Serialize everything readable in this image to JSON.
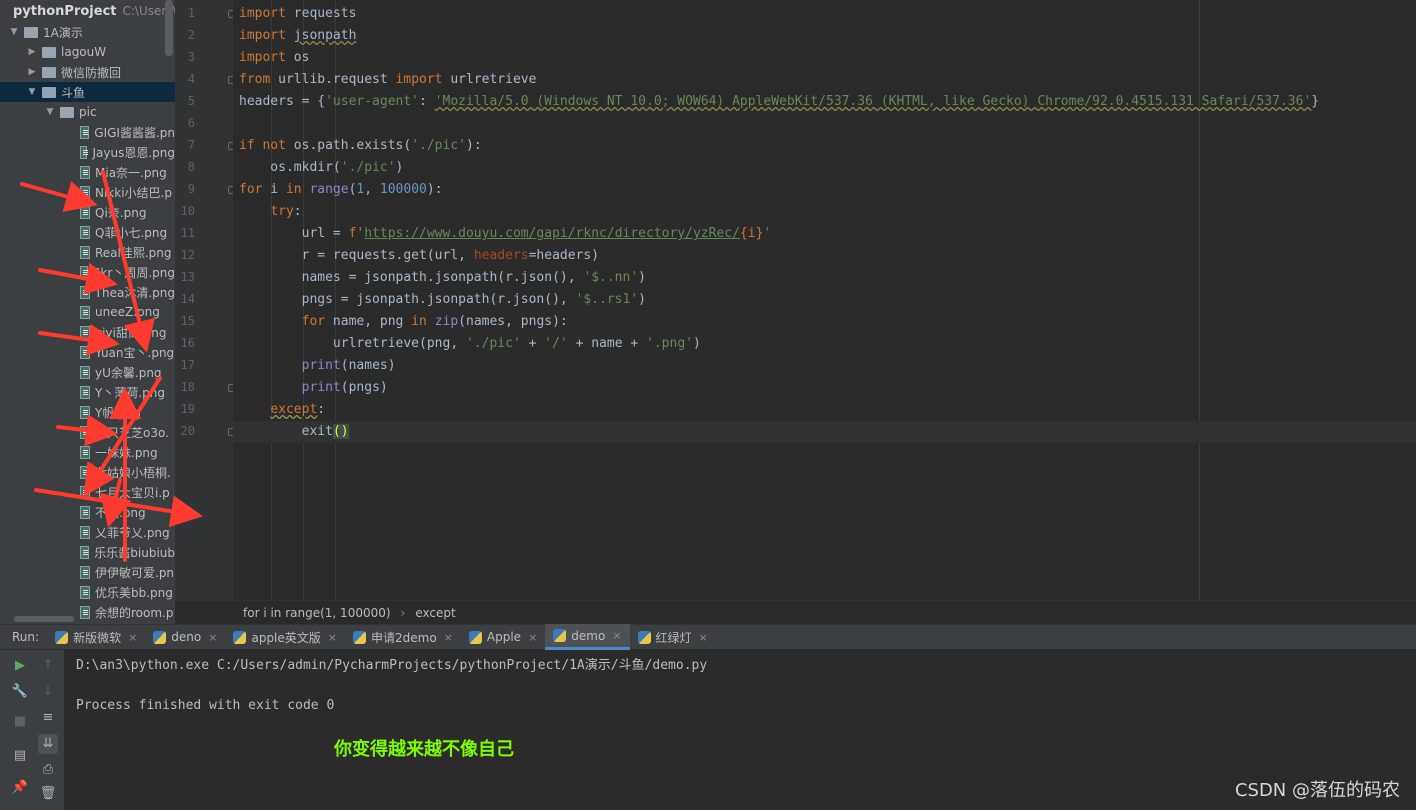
{
  "project": {
    "name": "pythonProject",
    "path": "C:\\Users\\"
  },
  "tree": [
    {
      "label": "1A演示",
      "type": "folder",
      "expanded": true,
      "level": 0
    },
    {
      "label": "lagouW",
      "type": "folder",
      "expanded": false,
      "level": 1
    },
    {
      "label": "微信防撤回",
      "type": "folder",
      "expanded": false,
      "level": 1
    },
    {
      "label": "斗鱼",
      "type": "folder",
      "expanded": true,
      "level": 1,
      "selected": true
    },
    {
      "label": "pic",
      "type": "folder",
      "expanded": true,
      "level": 2
    },
    {
      "label": "GIGI酱酱酱.pn",
      "type": "file",
      "level": 3
    },
    {
      "label": "Jayus恩恩.png",
      "type": "file",
      "level": 3
    },
    {
      "label": "Mia奈一.png",
      "type": "file",
      "level": 3
    },
    {
      "label": "Nikki小结巴.p",
      "type": "file",
      "level": 3
    },
    {
      "label": "Qi奈.png",
      "type": "file",
      "level": 3
    },
    {
      "label": "Q菲小七.png",
      "type": "file",
      "level": 3
    },
    {
      "label": "Real佳熙.png",
      "type": "file",
      "level": 3
    },
    {
      "label": "Skr丶周周.png",
      "type": "file",
      "level": 3
    },
    {
      "label": "Thea沐清.png",
      "type": "file",
      "level": 3
    },
    {
      "label": "uneeZ.png",
      "type": "file",
      "level": 3
    },
    {
      "label": "yiyi甜筒.png",
      "type": "file",
      "level": 3
    },
    {
      "label": "Yuan宝丶.png",
      "type": "file",
      "level": 3
    },
    {
      "label": "yU余馨.png",
      "type": "file",
      "level": 3
    },
    {
      "label": "Y丶薄荷.png",
      "type": "file",
      "level": 3
    },
    {
      "label": "Y帆.png",
      "type": "file",
      "level": 3
    },
    {
      "label": "一只芝芝o3o.",
      "type": "file",
      "level": 3
    },
    {
      "label": "一妹妹.png",
      "type": "file",
      "level": 3
    },
    {
      "label": "七姑娘小梧桐.",
      "type": "file",
      "level": 3
    },
    {
      "label": "七月大宝贝i.p",
      "type": "file",
      "level": 3
    },
    {
      "label": "不然.png",
      "type": "file",
      "level": 3
    },
    {
      "label": "乂菲爷乂.png",
      "type": "file",
      "level": 3
    },
    {
      "label": "乐乐酱biubiub",
      "type": "file",
      "level": 3
    },
    {
      "label": "伊伊敏可爱.pn",
      "type": "file",
      "level": 3
    },
    {
      "label": "优乐美bb.png",
      "type": "file",
      "level": 3
    },
    {
      "label": "余想的room.p",
      "type": "file",
      "level": 3
    }
  ],
  "line_numbers": [
    "1",
    "2",
    "3",
    "4",
    "5",
    "6",
    "7",
    "8",
    "9",
    "10",
    "11",
    "12",
    "13",
    "14",
    "15",
    "16",
    "17",
    "18",
    "19",
    "20"
  ],
  "code": {
    "l1a": "import",
    "l1b": " requests",
    "l2a": "import",
    "l2b": " ",
    "l2c": "jsonpath",
    "l3a": "import",
    "l3b": " os",
    "l4a": "from",
    "l4b": " urllib.request ",
    "l4c": "import",
    "l4d": " urlretrieve",
    "l5a": "headers = {",
    "l5b": "'user-agent'",
    "l5c": ": ",
    "l5d": "'Mozilla/5.0 (Windows NT 10.0; WOW64) AppleWebKit/537.36 (KHTML, like Gecko) Chrome/92.0.4515.131 Safari/537.36'",
    "l5e": "}",
    "l7a": "if not",
    "l7b": " os.path.exists(",
    "l7c": "'./pic'",
    "l7d": "):",
    "l8a": "    os.mkdir(",
    "l8b": "'./pic'",
    "l8c": ")",
    "l9a": "for",
    "l9b": " i ",
    "l9c": "in",
    "l9d": " ",
    "l9e": "range",
    "l9f": "(",
    "l9g": "1",
    "l9h": ", ",
    "l9i": "100000",
    "l9j": "):",
    "l10a": "    ",
    "l10b": "try",
    "l10c": ":",
    "l11a": "        url = ",
    "l11b": "f'",
    "l11c": "https://www.douyu.com/gapi/rknc/directory/yzRec/",
    "l11d": "{i}",
    "l11e": "'",
    "l12a": "        r = requests.get(url, ",
    "l12b": "headers",
    "l12c": "=headers)",
    "l13a": "        names = jsonpath.jsonpath(r.json(), ",
    "l13b": "'$..nn'",
    "l13c": ")",
    "l14a": "        pngs = jsonpath.jsonpath(r.json(), ",
    "l14b": "'$..rs1'",
    "l14c": ")",
    "l15a": "        ",
    "l15b": "for",
    "l15c": " name, png ",
    "l15d": "in",
    "l15e": " ",
    "l15f": "zip",
    "l15g": "(names, pngs):",
    "l16a": "            urlretrieve(png, ",
    "l16b": "'./pic'",
    "l16c": " + ",
    "l16d": "'/'",
    "l16e": " + name + ",
    "l16f": "'.png'",
    "l16g": ")",
    "l17a": "        ",
    "l17b": "print",
    "l17c": "(names)",
    "l18a": "        ",
    "l18b": "print",
    "l18c": "(pngs)",
    "l19a": "    ",
    "l19b": "except",
    "l19c": ":",
    "l20a": "        exit",
    "l20b": "()"
  },
  "breadcrumb": {
    "item1": "for i in range(1, 100000)",
    "separator": "›",
    "item2": "except"
  },
  "run": {
    "label": "Run:",
    "tabs": [
      {
        "label": "新版微软",
        "active": false
      },
      {
        "label": "deno",
        "active": false
      },
      {
        "label": "apple英文版",
        "active": false
      },
      {
        "label": "申请2demo",
        "active": false
      },
      {
        "label": "Apple",
        "active": false
      },
      {
        "label": "demo",
        "active": true
      },
      {
        "label": "红绿灯",
        "active": false
      }
    ],
    "close_glyph": "×"
  },
  "console": {
    "command": "D:\\an3\\python.exe C:/Users/admin/PycharmProjects/pythonProject/1A演示/斗鱼/demo.py",
    "result": "Process finished with exit code 0"
  },
  "caption": "你变得越来越不像自己",
  "watermark": "CSDN @落伍的码农",
  "colors": {
    "keyword": "#cc7832",
    "string": "#6a8759",
    "builtin": "#8888c6",
    "annotation_arrow": "#ff3b30",
    "caption": "#7cfc00"
  },
  "toolbar_icons": [
    "run-icon",
    "up-arrow-icon",
    "wrench-icon",
    "down-arrow-icon",
    "stop-icon",
    "soft-wrap-icon",
    "layout-icon",
    "scroll-to-end-icon",
    "print-icon",
    "pin-icon",
    "trash-icon"
  ]
}
